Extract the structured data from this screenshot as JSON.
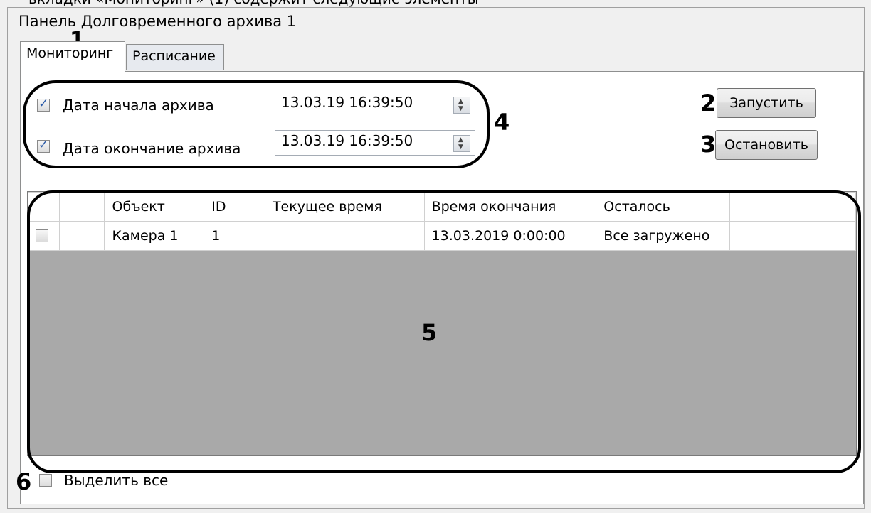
{
  "header_caption": "вкладки «Мониторинг» (1) содержит следующие элементы",
  "window": {
    "title": "Панель Долговременного архива 1"
  },
  "tabs": [
    {
      "label": "Мониторинг",
      "active": true
    },
    {
      "label": "Расписание",
      "active": false
    }
  ],
  "dates": {
    "start": {
      "label": "Дата начала архива",
      "value": "13.03.19 16:39:50",
      "checked": true
    },
    "end": {
      "label": "Дата окончание архива",
      "value": "13.03.19 16:39:50",
      "checked": true
    }
  },
  "buttons": {
    "start_label": "Запустить",
    "stop_label": "Остановить"
  },
  "table": {
    "columns": [
      "",
      "",
      "Объект",
      "ID",
      "Текущее время",
      "Время окончания",
      "Осталось",
      ""
    ],
    "rows": [
      {
        "checked": false,
        "object": "Камера 1",
        "id": "1",
        "current_time": "",
        "end_time": "13.03.2019 0:00:00",
        "remaining": "Все загружено"
      }
    ]
  },
  "select_all": {
    "label": "Выделить все",
    "checked": false
  },
  "annotations": [
    "1",
    "2",
    "3",
    "4",
    "5",
    "6"
  ],
  "colors": {
    "grid_background": "#a9a9a9",
    "window_background": "#f0f0f0",
    "checkbox_accent": "#2a5aa8"
  }
}
